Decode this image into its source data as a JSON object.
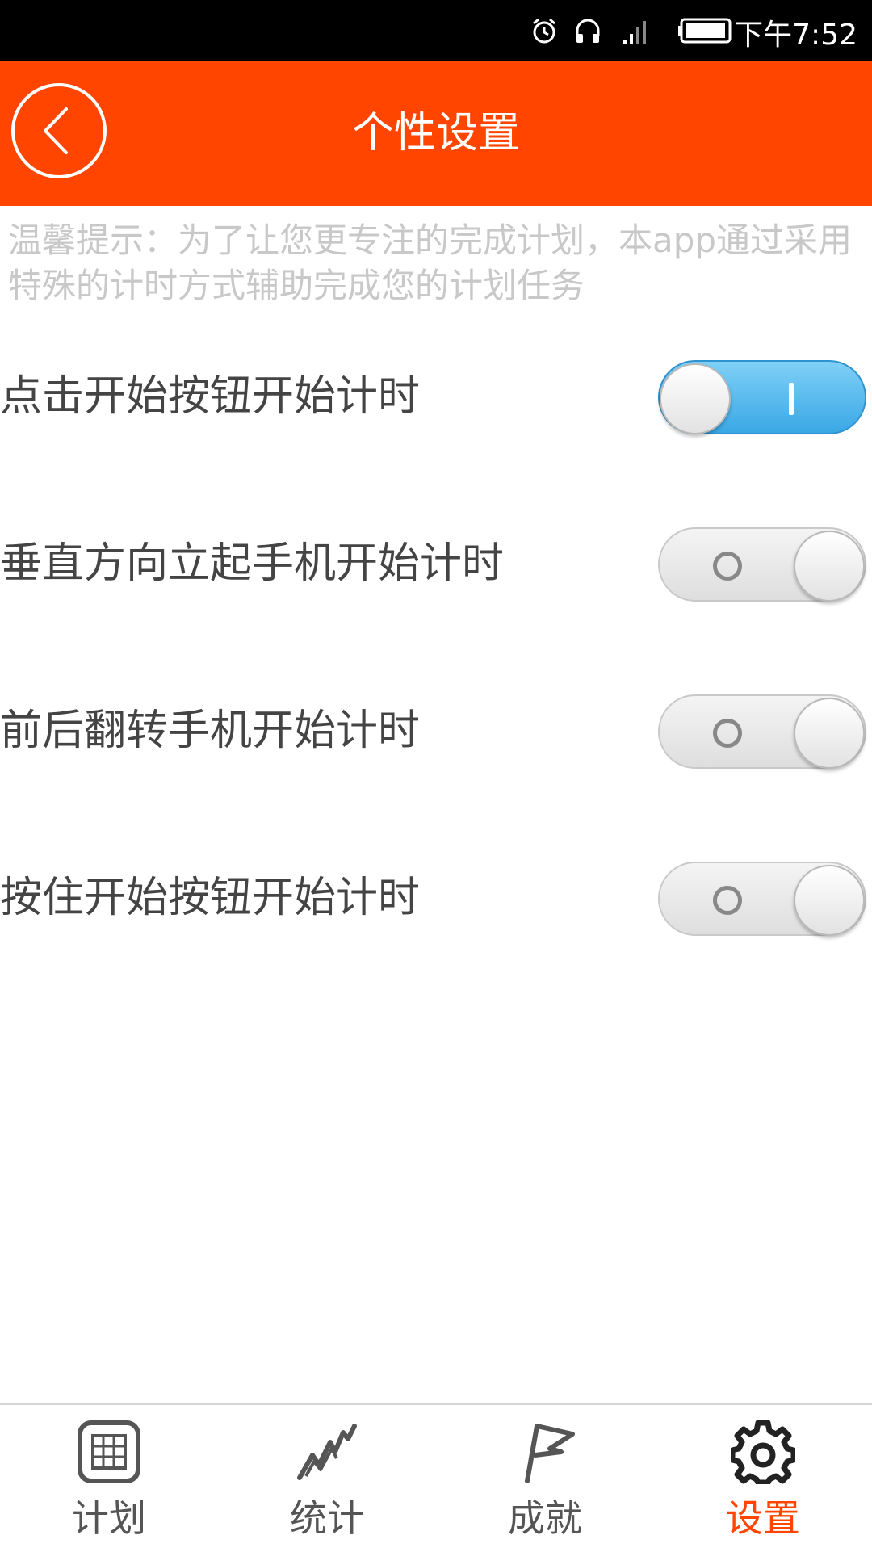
{
  "status_bar": {
    "time": "下午7:52"
  },
  "header": {
    "title": "个性设置"
  },
  "tip": {
    "text": "温馨提示：为了让您更专注的完成计划，本app通过采用特殊的计时方式辅助完成您的计划任务"
  },
  "settings": [
    {
      "label": "点击开始按钮开始计时",
      "enabled": true
    },
    {
      "label": "垂直方向立起手机开始计时",
      "enabled": false
    },
    {
      "label": "前后翻转手机开始计时",
      "enabled": false
    },
    {
      "label": "按住开始按钮开始计时",
      "enabled": false
    }
  ],
  "bottom_nav": [
    {
      "label": "计划",
      "icon": "calendar-grid-icon",
      "active": false
    },
    {
      "label": "统计",
      "icon": "zigzag-chart-icon",
      "active": false
    },
    {
      "label": "成就",
      "icon": "flag-icon",
      "active": false
    },
    {
      "label": "设置",
      "icon": "gear-icon",
      "active": true
    }
  ],
  "colors": {
    "accent": "#ff4500",
    "toggle_on": "#3aa8e6",
    "tip_text": "#c8c8c8"
  }
}
